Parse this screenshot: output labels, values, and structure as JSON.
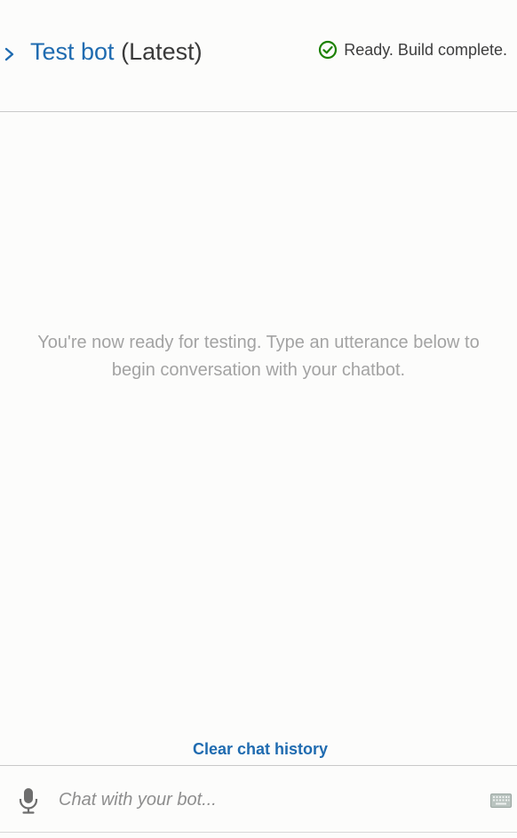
{
  "header": {
    "title": "Test bot",
    "version": "(Latest)",
    "status_text": "Ready. Build complete.",
    "status_icon": "check-circle-icon",
    "collapse_icon": "chevron-right-icon"
  },
  "conversation": {
    "empty_message": "You're now ready for testing. Type an utterance below to begin conversation with your chatbot."
  },
  "actions": {
    "clear_history_label": "Clear chat history"
  },
  "input": {
    "placeholder": "Chat with your bot...",
    "value": "",
    "mic_icon": "microphone-icon",
    "keyboard_icon": "keyboard-icon"
  },
  "colors": {
    "accent": "#1f6bb0",
    "success": "#1d8102",
    "muted_text": "#a3a3a3",
    "background": "#fcfcfb"
  }
}
